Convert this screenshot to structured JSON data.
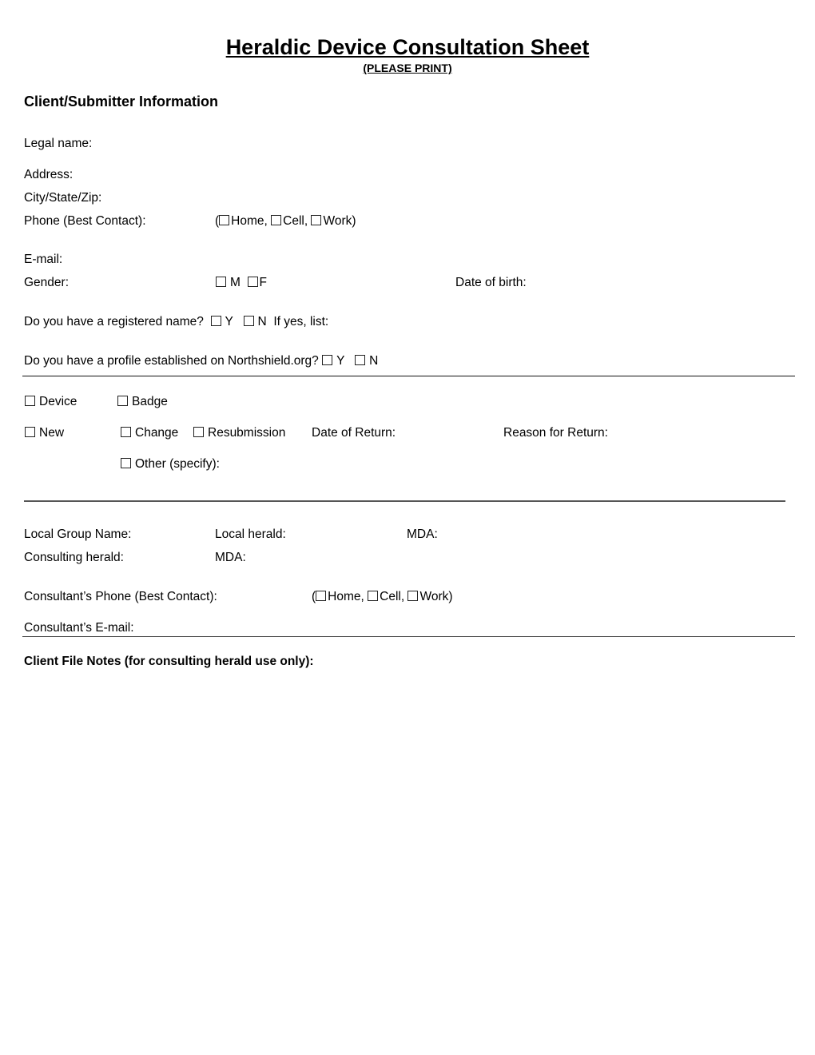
{
  "header": {
    "title": "Heraldic Device Consultation Sheet",
    "subtitle": "(PLEASE PRINT)"
  },
  "client": {
    "heading": "Client/Submitter Information",
    "legal_name_label": "Legal name:",
    "address_label": "Address:",
    "city_state_zip_label": "City/State/Zip:",
    "phone_label": "Phone (Best Contact):",
    "phone_open_paren": "(",
    "phone_options": [
      "Home,",
      "Cell,",
      "Work)"
    ],
    "email_label": "E-mail:",
    "gender_label": "Gender:",
    "gender_options": [
      "M",
      "F"
    ],
    "dob_label": "Date of birth:",
    "registered_name_question": "Do you have a registered name?",
    "registered_name_options": [
      "Y",
      "N"
    ],
    "registered_name_followup": "If yes, list:",
    "profile_question": "Do you have a profile established on Northshield.org?",
    "profile_options": [
      "Y",
      "N"
    ]
  },
  "submission": {
    "type_options": [
      "Device",
      "Badge"
    ],
    "new_label": "New",
    "change_label": "Change",
    "resubmission_label": "Resubmission",
    "date_of_return_label": "Date of Return:",
    "reason_for_return_label": "Reason for Return:",
    "other_label": "Other (specify):",
    "divider_text": "______________________________________________________________________________________________________________________"
  },
  "consultant": {
    "local_group_label": "Local Group Name:",
    "local_herald_label": "Local herald:",
    "mda_label_1": "MDA:",
    "consulting_herald_label": "Consulting herald:",
    "mda_label_2": "MDA:",
    "phone_label": "Consultant’s Phone (Best Contact):",
    "phone_open_paren": "(",
    "phone_options": [
      "Home,",
      "Cell,",
      "Work)"
    ],
    "email_label": "Consultant’s E-mail:"
  },
  "notes": {
    "heading": "Client File Notes (for consulting herald use only):"
  }
}
